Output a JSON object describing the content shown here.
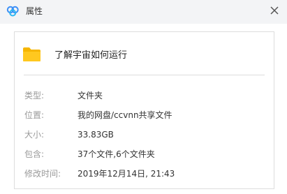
{
  "window": {
    "title": "属性",
    "app_icon": "cloud-icon",
    "close_icon": "close-icon"
  },
  "item": {
    "name": "了解宇宙如何运行",
    "icon": "folder-icon",
    "icon_color": "#ffc81f"
  },
  "properties": [
    {
      "label": "类型:",
      "value": "文件夹"
    },
    {
      "label": "位置:",
      "value": "我的网盘/ccvnn共享文件"
    },
    {
      "label": "大小:",
      "value": "33.83GB"
    },
    {
      "label": "包含:",
      "value": "37个文件,6个文件夹"
    },
    {
      "label": "修改时间:",
      "value": "2019年12月14日, 21:43"
    }
  ],
  "colors": {
    "titlebar": "#f3f4f6",
    "label_text": "#999999",
    "value_text": "#333333",
    "cloud_blue": "#3b8ff7"
  }
}
